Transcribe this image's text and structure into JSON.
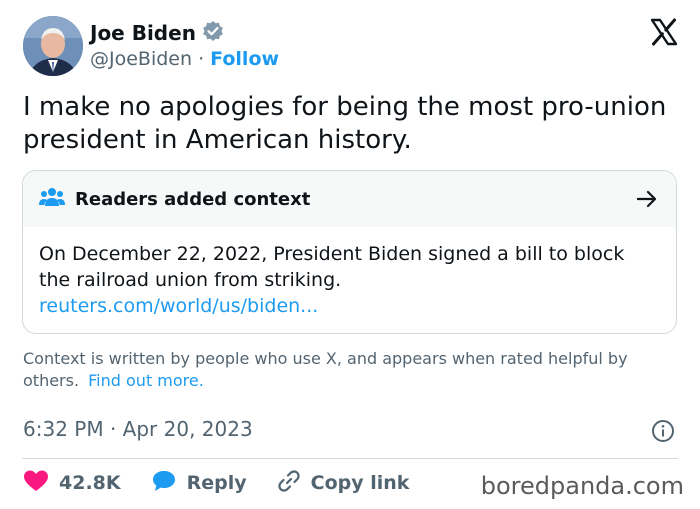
{
  "author": {
    "display_name": "Joe Biden",
    "handle": "@JoeBiden",
    "separator": " · ",
    "follow_label": "Follow",
    "verified_color": "#829aab"
  },
  "brand": {
    "icon": "x-logo-icon"
  },
  "tweet": {
    "text": "I make no apologies for being the most pro-union president in American history."
  },
  "context_note": {
    "title": "Readers added context",
    "body": "On December 22, 2022, President Biden signed a bill to block the railroad union from striking.",
    "link": "reuters.com/world/us/biden..."
  },
  "disclaimer": {
    "text": "Context is written by people who use X, and appears when rated helpful by others.",
    "link": "Find out more."
  },
  "meta": {
    "timestamp": "6:32 PM · Apr 20, 2023"
  },
  "actions": {
    "likes": "42.8K",
    "reply": "Reply",
    "copy_link": "Copy link"
  },
  "watermark": "boredpanda.com",
  "colors": {
    "accent": "#1d9bf0",
    "like": "#f91880",
    "muted": "#536471"
  }
}
